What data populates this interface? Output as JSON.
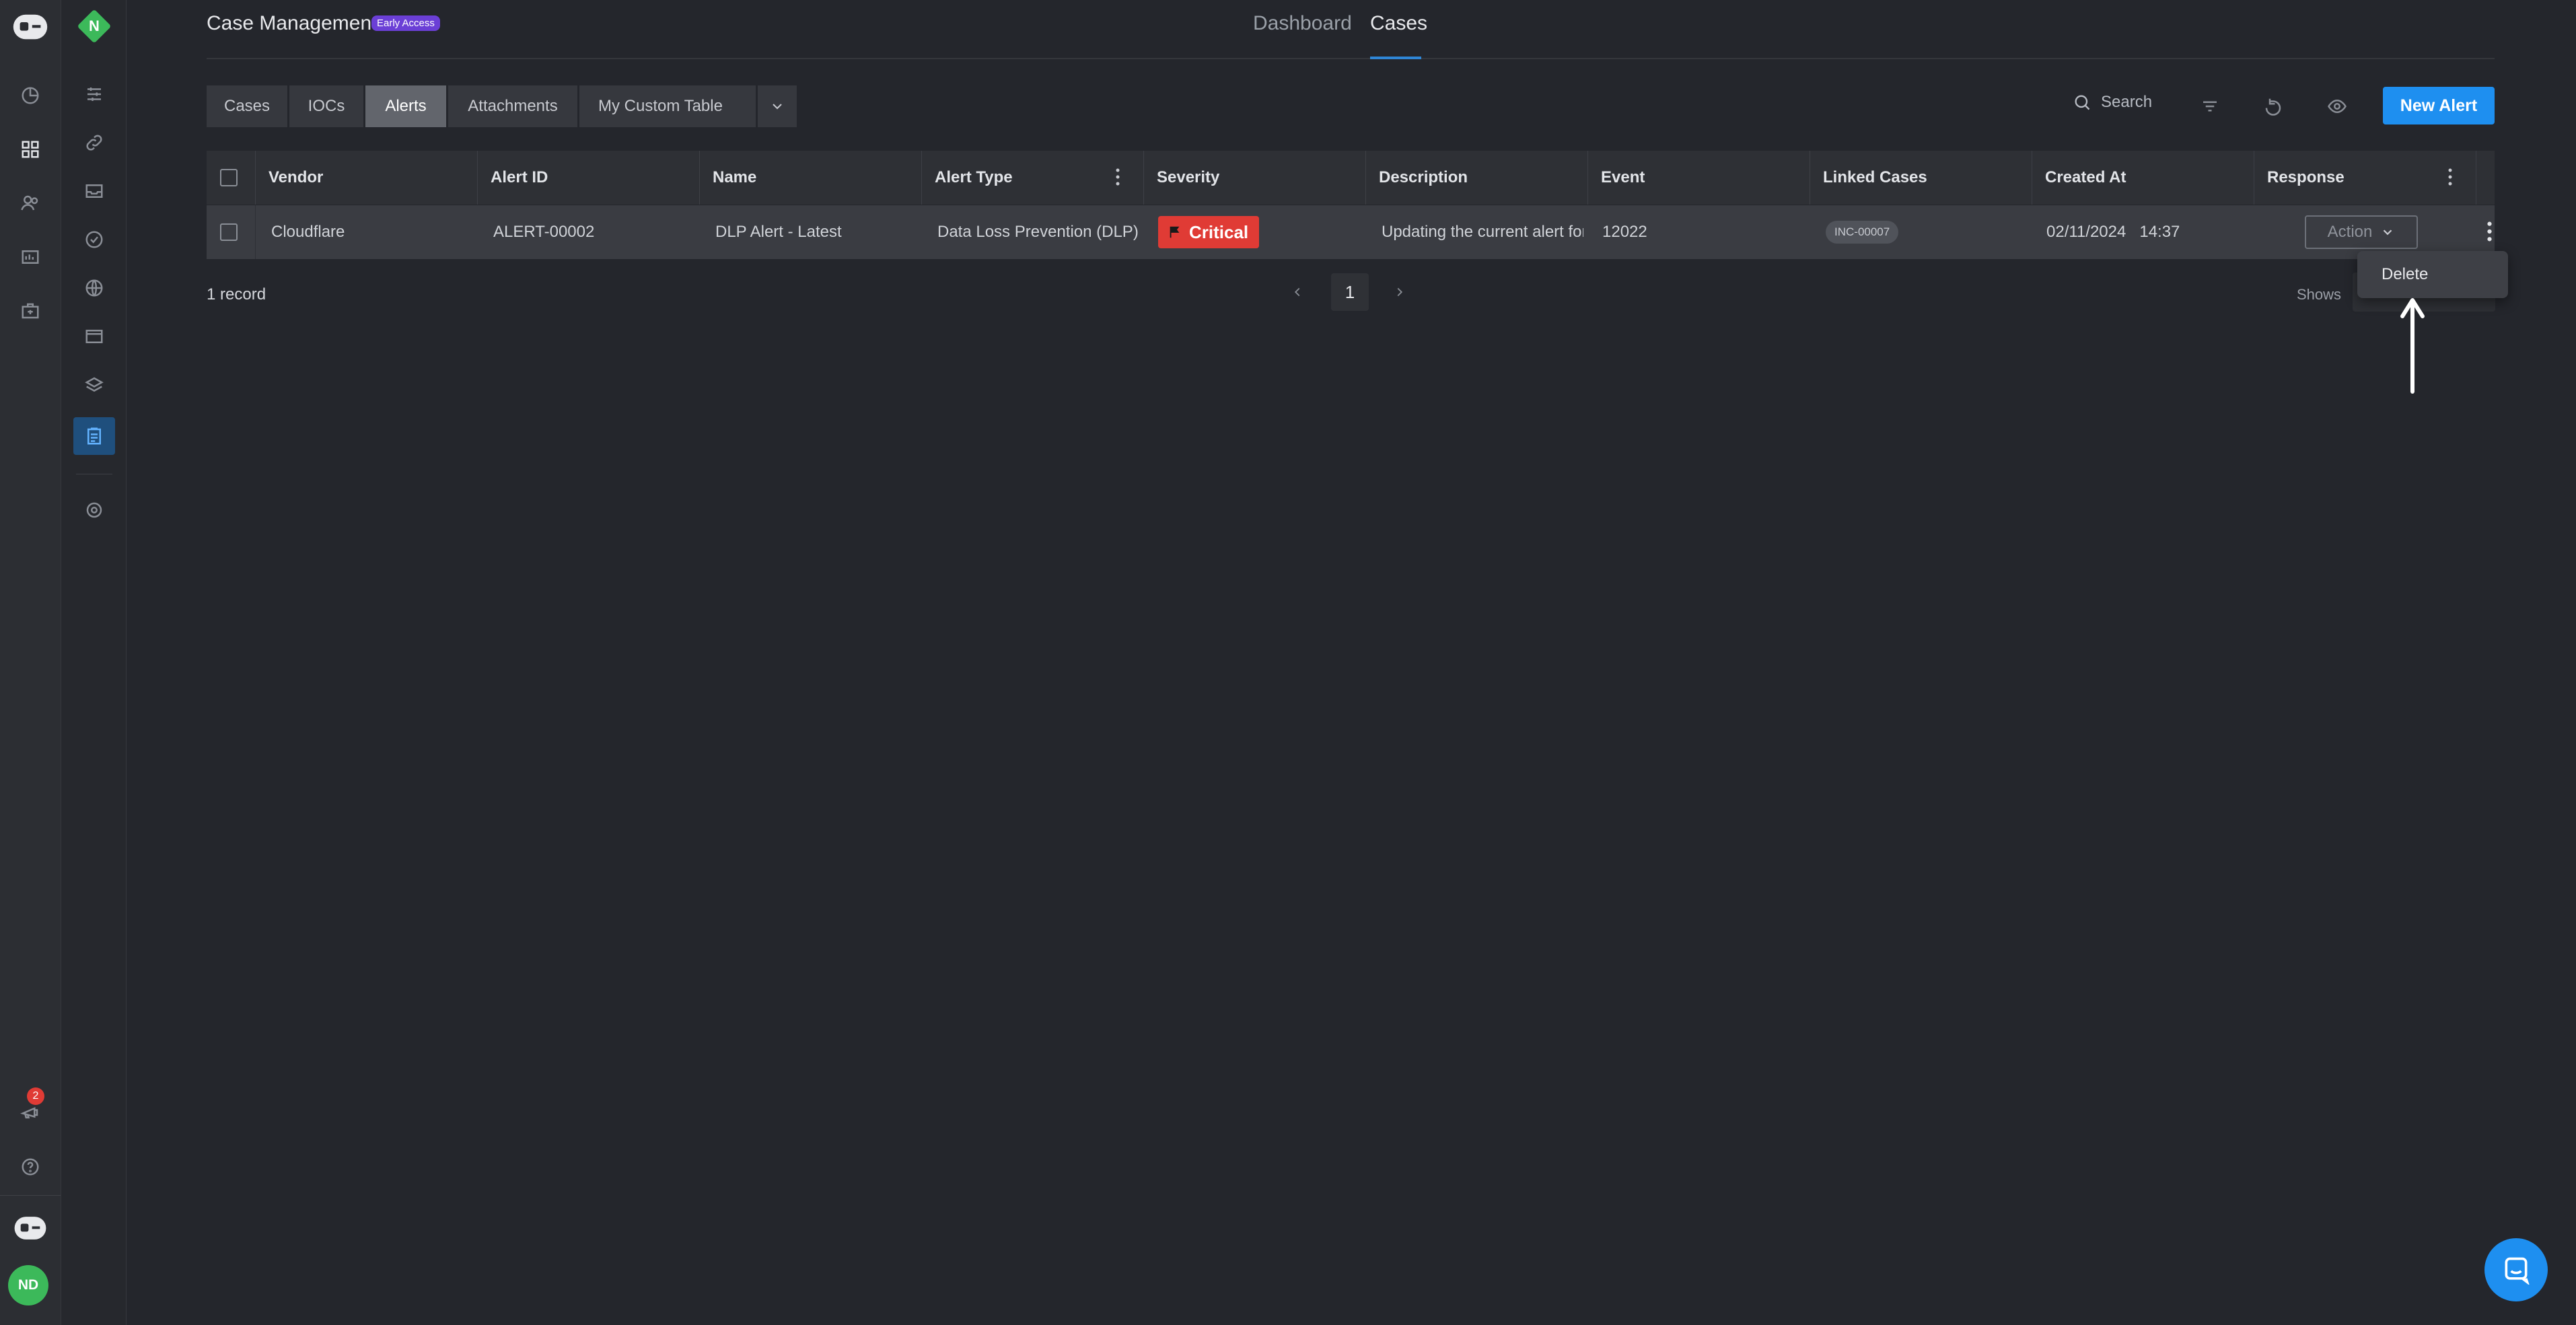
{
  "header": {
    "title": "Case Management",
    "badge": "Early Access",
    "nav": [
      "Dashboard",
      "Cases"
    ]
  },
  "tabs": [
    "Cases",
    "IOCs",
    "Alerts",
    "Attachments",
    "My Custom Table"
  ],
  "toolbar": {
    "search_label": "Search",
    "new_alert": "New Alert"
  },
  "table": {
    "columns": [
      "Vendor",
      "Alert ID",
      "Name",
      "Alert Type",
      "Severity",
      "Description",
      "Event",
      "Linked Cases",
      "Created At",
      "Response"
    ],
    "rows": [
      {
        "vendor": "Cloudflare",
        "alert_id": "ALERT-00002",
        "name": "DLP Alert - Latest",
        "alert_type": "Data Loss Prevention (DLP)",
        "severity": "Critical",
        "description": "Updating the current alert for",
        "event": "12022",
        "linked_case": "INC-00007",
        "created_date": "02/11/2024",
        "created_time": "14:37",
        "action": "Action"
      }
    ]
  },
  "footer": {
    "records": "1 record",
    "page": "1",
    "shows": "Shows"
  },
  "dropdown": {
    "delete": "Delete"
  },
  "sidebar": {
    "notifications": "2",
    "avatar": "ND",
    "org": "N"
  },
  "colors": {
    "accent": "#1e8ff0",
    "critical": "#e03b35",
    "badge": "#6b3fd6",
    "bg": "#24262c"
  }
}
